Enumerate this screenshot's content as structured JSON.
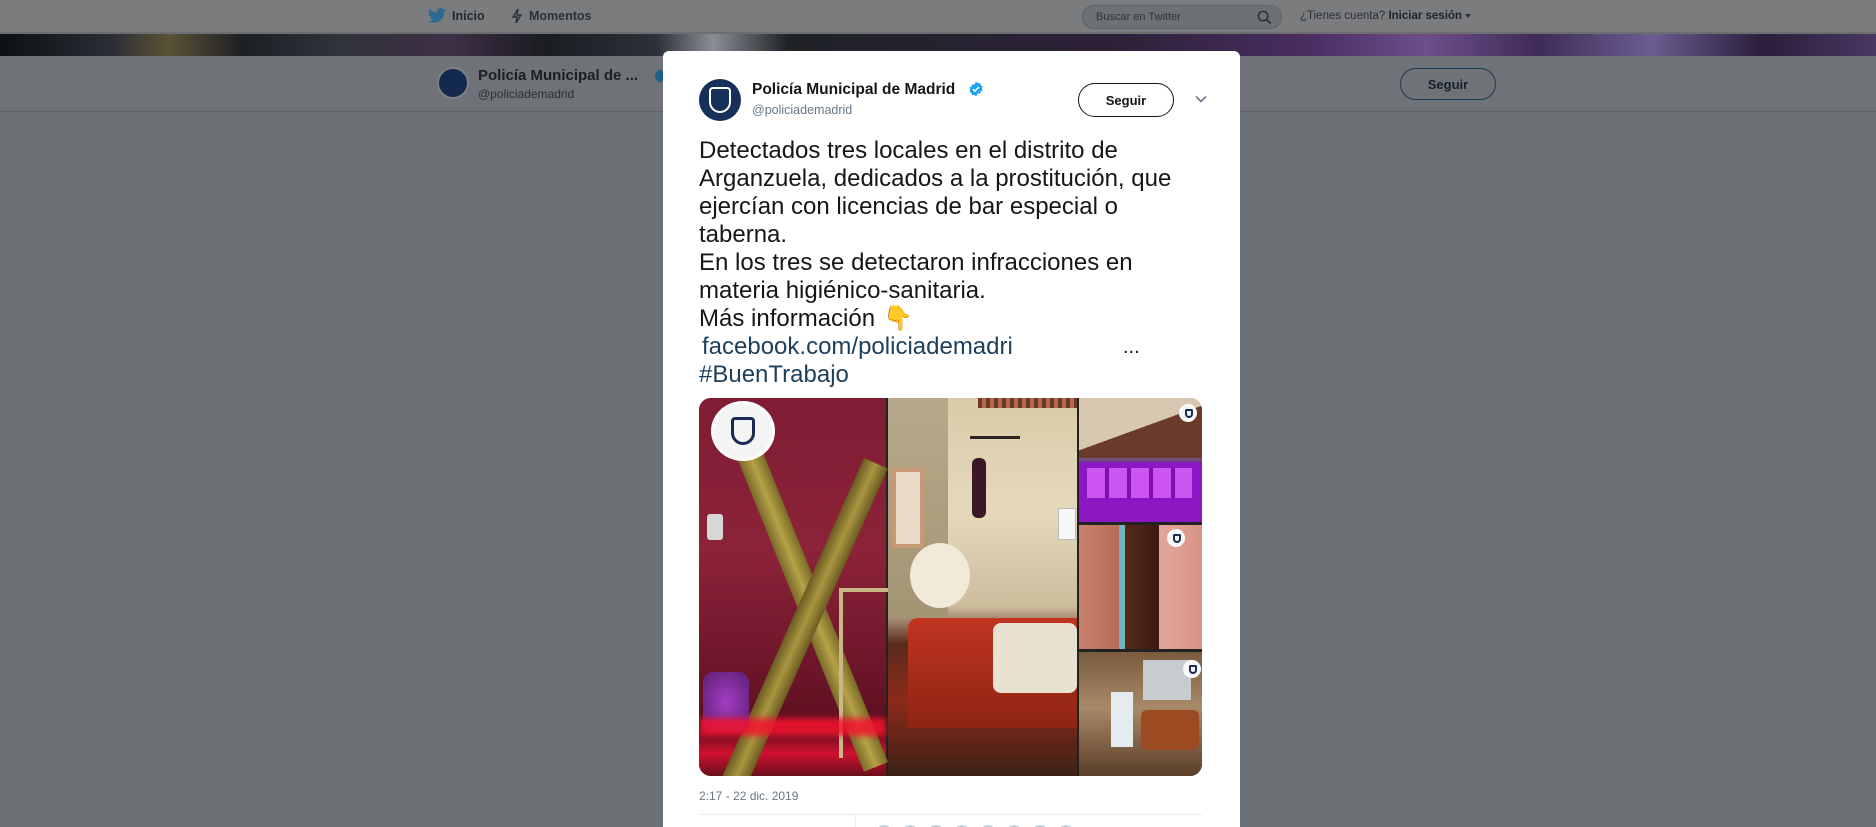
{
  "topnav": {
    "home_label": "Inicio",
    "moments_label": "Momentos",
    "search_placeholder": "Buscar en Twitter",
    "have_account_text": "¿Tienes cuenta?",
    "login_label": "Iniciar sesión"
  },
  "profile_header": {
    "name": "Policía Municipal de ...",
    "handle": "@policiademadrid",
    "follow_label": "Seguir"
  },
  "tweet": {
    "author_name": "Policía Municipal de Madrid",
    "author_handle": "@policiademadrid",
    "verified": true,
    "follow_label": "Seguir",
    "text_lines": [
      "Detectados tres locales en el distrito de",
      "Arganzuela, dedicados a la prostitución, que",
      "ejercían con licencias de bar especial o",
      "taberna.",
      "En los tres se detectaron infracciones en",
      "materia higiénico-sanitaria.",
      "Más información"
    ],
    "emoji": "👇",
    "link_text": "facebook.com/policiademadri",
    "link_ellipsis": "...",
    "hashtag": "#BuenTrabajo",
    "timestamp": "2:17 - 22 dic. 2019",
    "media_count": 5
  },
  "colors": {
    "link": "#1b3f5d",
    "verified_badge": "#1da1f2",
    "overlay": "#6c7176",
    "card_bg": "#ffffff"
  },
  "icons": {
    "home": "twitter-bird-icon",
    "moments": "lightning-icon",
    "search": "search-icon",
    "verified": "verified-badge-icon",
    "caret": "chevron-down-icon"
  }
}
